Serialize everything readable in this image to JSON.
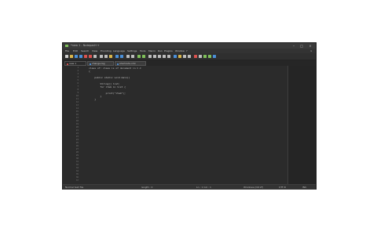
{
  "window": {
    "title": "*new 1 - Notepad++",
    "controls": {
      "minimize": "–",
      "maximize": "□",
      "close": "×"
    }
  },
  "menubar": {
    "items": [
      "File",
      "Edit",
      "Search",
      "View",
      "Encoding",
      "Language",
      "Settings",
      "Tools",
      "Macro",
      "Run",
      "Plugins",
      "Window",
      "?"
    ],
    "close_glyph": "×"
  },
  "tabs": [
    {
      "label": "new 1"
    },
    {
      "label": "change.log"
    },
    {
      "label": "shortcuts.xml"
    }
  ],
  "gutter": {
    "line_numbers": [
      "1",
      "2",
      "3",
      "4",
      "5",
      "6",
      "7",
      "8",
      "9",
      "10",
      "11",
      "12",
      "13",
      "14",
      "15",
      "16",
      "17",
      "18",
      "19",
      "20",
      "21",
      "22",
      "23",
      "24",
      "25",
      "26",
      "27",
      "28",
      "29",
      "30",
      "31",
      "32",
      "33",
      "34",
      "35",
      "36",
      "37"
    ]
  },
  "editor": {
    "lines": [
      "class of: class is of document in C.C",
      "{",
      "",
      "    public static void main()",
      "",
      "        String[] list;",
      "        for item in list {",
      "",
      "            print(\"item\");",
      "        }",
      "    }"
    ]
  },
  "statusbar": {
    "file_type": "Normal text file",
    "length": "length : 0",
    "position": "Ln : 1  Col : 1",
    "eol": "Windows (CR LF)",
    "encoding": "UTF-8",
    "mode": "INS"
  },
  "colors": {
    "background": "#2b2b2b",
    "toolbar": "#2f2f2f",
    "accent_green": "#7fbf5a",
    "accent_blue": "#4a8fd8",
    "accent_red": "#d9534f",
    "accent_yellow": "#d8b44a"
  }
}
